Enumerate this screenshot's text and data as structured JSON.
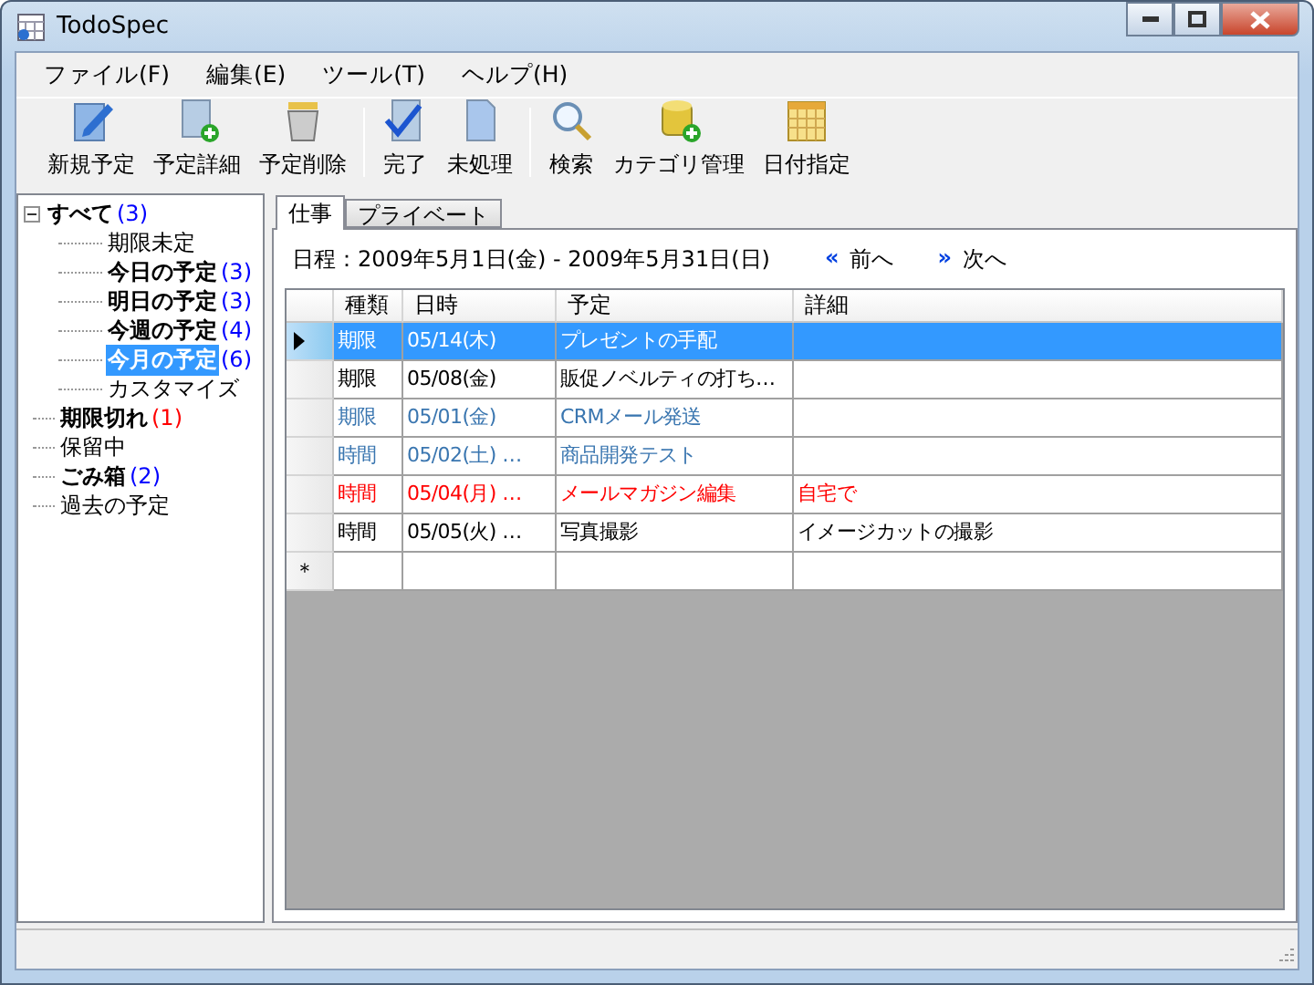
{
  "window": {
    "title": "TodoSpec"
  },
  "menu": [
    "ファイル(F)",
    "編集(E)",
    "ツール(T)",
    "ヘルプ(H)"
  ],
  "toolbar": [
    {
      "label": "新規予定",
      "kind": "new"
    },
    {
      "label": "予定詳細",
      "kind": "detail"
    },
    {
      "label": "予定削除",
      "kind": "delete",
      "group_end": true
    },
    {
      "label": "完了",
      "kind": "done"
    },
    {
      "label": "未処理",
      "kind": "pending",
      "group_end": true
    },
    {
      "label": "検索",
      "kind": "search"
    },
    {
      "label": "カテゴリ管理",
      "kind": "category"
    },
    {
      "label": "日付指定",
      "kind": "calendar"
    }
  ],
  "tree": [
    {
      "label": "すべて",
      "bold": true,
      "count": {
        "text": "(3)",
        "color": "#0000ff"
      },
      "selected": false,
      "expanded": true,
      "children": [
        {
          "label": "期限未定",
          "bold": false,
          "selected": false
        },
        {
          "label": "今日の予定",
          "bold": true,
          "count": {
            "text": "(3)",
            "color": "#0000ff"
          },
          "selected": false
        },
        {
          "label": "明日の予定",
          "bold": true,
          "count": {
            "text": "(3)",
            "color": "#0000ff"
          },
          "selected": false
        },
        {
          "label": "今週の予定",
          "bold": true,
          "count": {
            "text": "(4)",
            "color": "#0000ff"
          },
          "selected": false
        },
        {
          "label": "今月の予定",
          "bold": true,
          "count": {
            "text": "(6)",
            "color": "#0000ff"
          },
          "selected": true
        },
        {
          "label": "カスタマイズ",
          "bold": false,
          "selected": false
        }
      ]
    },
    {
      "label": "期限切れ",
      "bold": true,
      "count": {
        "text": "(1)",
        "color": "#ff0000"
      },
      "selected": false
    },
    {
      "label": "保留中",
      "bold": false,
      "selected": false
    },
    {
      "label": "ごみ箱",
      "bold": true,
      "count": {
        "text": "(2)",
        "color": "#0000ff"
      },
      "selected": false
    },
    {
      "label": "過去の予定",
      "bold": false,
      "selected": false
    }
  ],
  "tabs": [
    {
      "label": "仕事",
      "selected": true
    },
    {
      "label": "プライベート",
      "selected": false
    }
  ],
  "schedule": {
    "label": "日程：2009年5月1日(金) - 2009年5月31日(日)",
    "prev_icon": "«",
    "prev": "前へ",
    "next_icon": "»",
    "next": "次へ"
  },
  "table": {
    "columns": [
      "種類",
      "日時",
      "予定",
      "詳細"
    ],
    "rows": [
      {
        "cells": [
          "期限",
          "05/14(木)",
          "プレゼントの手配",
          ""
        ],
        "selected": true
      },
      {
        "cells": [
          "期限",
          "05/08(金)",
          "販促ノベルティの打ち…",
          ""
        ],
        "color": "#000000",
        "selected": false
      },
      {
        "cells": [
          "期限",
          "05/01(金)",
          "CRMメール発送",
          ""
        ],
        "color": "#3a76b0",
        "selected": false
      },
      {
        "cells": [
          "時間",
          "05/02(土) …",
          "商品開発テスト",
          ""
        ],
        "color": "#3a76b0",
        "selected": false
      },
      {
        "cells": [
          "時間",
          "05/04(月) …",
          "メールマガジン編集",
          "自宅で"
        ],
        "color": "#ff0000",
        "selected": false
      },
      {
        "cells": [
          "時間",
          "05/05(火) …",
          "写真撮影",
          "イメージカットの撮影"
        ],
        "color": "#000000",
        "selected": false
      }
    ],
    "new_row_marker": "＊"
  }
}
